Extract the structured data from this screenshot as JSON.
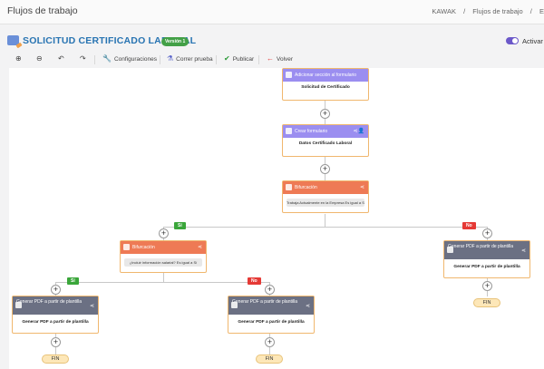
{
  "topbar": {
    "title": "Flujos de trabajo",
    "breadcrumbs": [
      "KAWAK",
      "Flujos de trabajo",
      "E"
    ]
  },
  "header": {
    "flow_name": "SOLICITUD CERTIFICADO LABORAL",
    "version": "Versión 1",
    "toggle_label": "Activar"
  },
  "toolbar": {
    "zoom_in_icon": "zoom-in-icon",
    "zoom_out_icon": "zoom-out-icon",
    "undo_icon": "undo-icon",
    "redo_icon": "redo-icon",
    "settings": "Configuraciones",
    "test": "Correr prueba",
    "publish": "Publicar",
    "back": "Volver"
  },
  "colors": {
    "accent": "#2874b2",
    "section_header": "#9b8ef0",
    "branch_header": "#ee7a55",
    "pdf_header": "#6b7083",
    "yes": "#3aa63a",
    "no": "#e53935"
  },
  "nodes": {
    "n1": {
      "header": "Adicionar sección al formulario",
      "body": "Solicitud de Certificado"
    },
    "n2": {
      "header": "Crear formulario",
      "body": "Datos Certificado Laboral"
    },
    "n3": {
      "header": "Bifurcación",
      "condition": "Trabaja Actualmente en la Empresa Es igual a Sí"
    },
    "n4": {
      "header": "Bifurcación",
      "condition": "¿Incluir información salarial? Es igual a Sí"
    },
    "n5": {
      "header": "Generar PDF a partir de plantilla",
      "body": "Generar PDF a partir de plantilla"
    },
    "n6": {
      "header": "Generar PDF a partir de plantilla",
      "body": "Generar PDF a partir de plantilla"
    },
    "n7": {
      "header": "Generar PDF a partir de plantilla",
      "body": "Generar PDF a partir de plantilla"
    }
  },
  "branches": {
    "yes": "Sí",
    "no": "No"
  },
  "end_label": "FIN"
}
